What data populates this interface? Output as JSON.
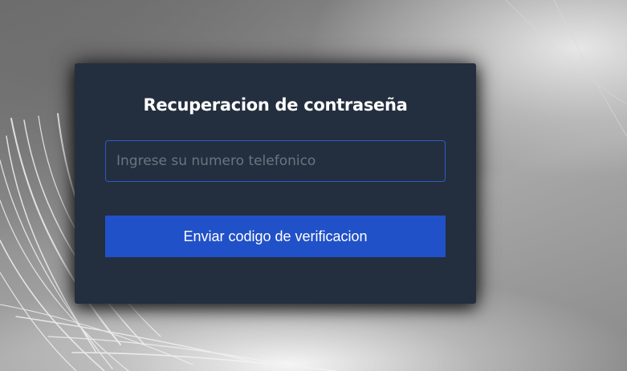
{
  "card": {
    "title": "Recuperacion de contraseña"
  },
  "phone_input": {
    "placeholder": "Ingrese su numero telefonico",
    "value": ""
  },
  "send_button": {
    "label": "Enviar codigo de verificacion"
  },
  "colors": {
    "card_background": "#232f3e",
    "input_border": "#2e59c7",
    "button_background": "#2151c8",
    "text": "#ffffff"
  }
}
